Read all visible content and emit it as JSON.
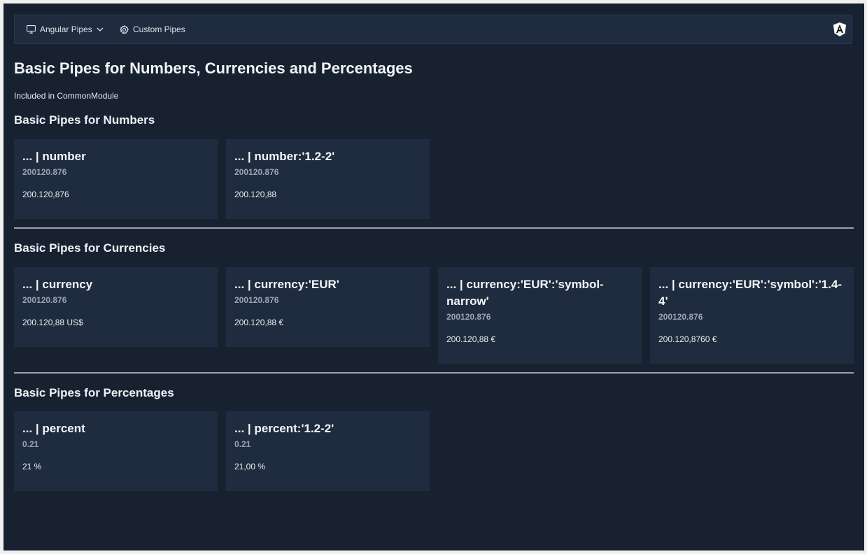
{
  "nav": {
    "items": [
      {
        "label": "Angular Pipes",
        "icon": "monitor-icon",
        "has_dropdown": true
      },
      {
        "label": "Custom Pipes",
        "icon": "gear-icon",
        "has_dropdown": false
      }
    ],
    "logo": "angular-logo-icon"
  },
  "page": {
    "title": "Basic Pipes for Numbers, Currencies and Percentages",
    "subtitle": "Included in CommonModule"
  },
  "sections": [
    {
      "heading": "Basic Pipes for Numbers",
      "cards": [
        {
          "title": "... | number",
          "input": "200120.876",
          "result": "200.120,876"
        },
        {
          "title": "... | number:'1.2-2'",
          "input": "200120.876",
          "result": "200.120,88"
        }
      ]
    },
    {
      "heading": "Basic Pipes for Currencies",
      "cards": [
        {
          "title": "... | currency",
          "input": "200120.876",
          "result": "200.120,88 US$"
        },
        {
          "title": "... | currency:'EUR'",
          "input": "200120.876",
          "result": "200.120,88 €"
        },
        {
          "title": "... | currency:'EUR':'symbol-narrow'",
          "input": "200120.876",
          "result": "200.120,88 €"
        },
        {
          "title": "... | currency:'EUR':'symbol':'1.4-4'",
          "input": "200120.876",
          "result": "200.120,8760 €"
        }
      ]
    },
    {
      "heading": "Basic Pipes for Percentages",
      "cards": [
        {
          "title": "... | percent",
          "input": "0.21",
          "result": "21 %"
        },
        {
          "title": "... | percent:'1.2-2'",
          "input": "0.21",
          "result": "21,00 %"
        }
      ]
    }
  ],
  "colors": {
    "background": "#182130",
    "card": "#1f2c3f",
    "text": "#f1f4f8",
    "muted": "#9aa4b2"
  }
}
